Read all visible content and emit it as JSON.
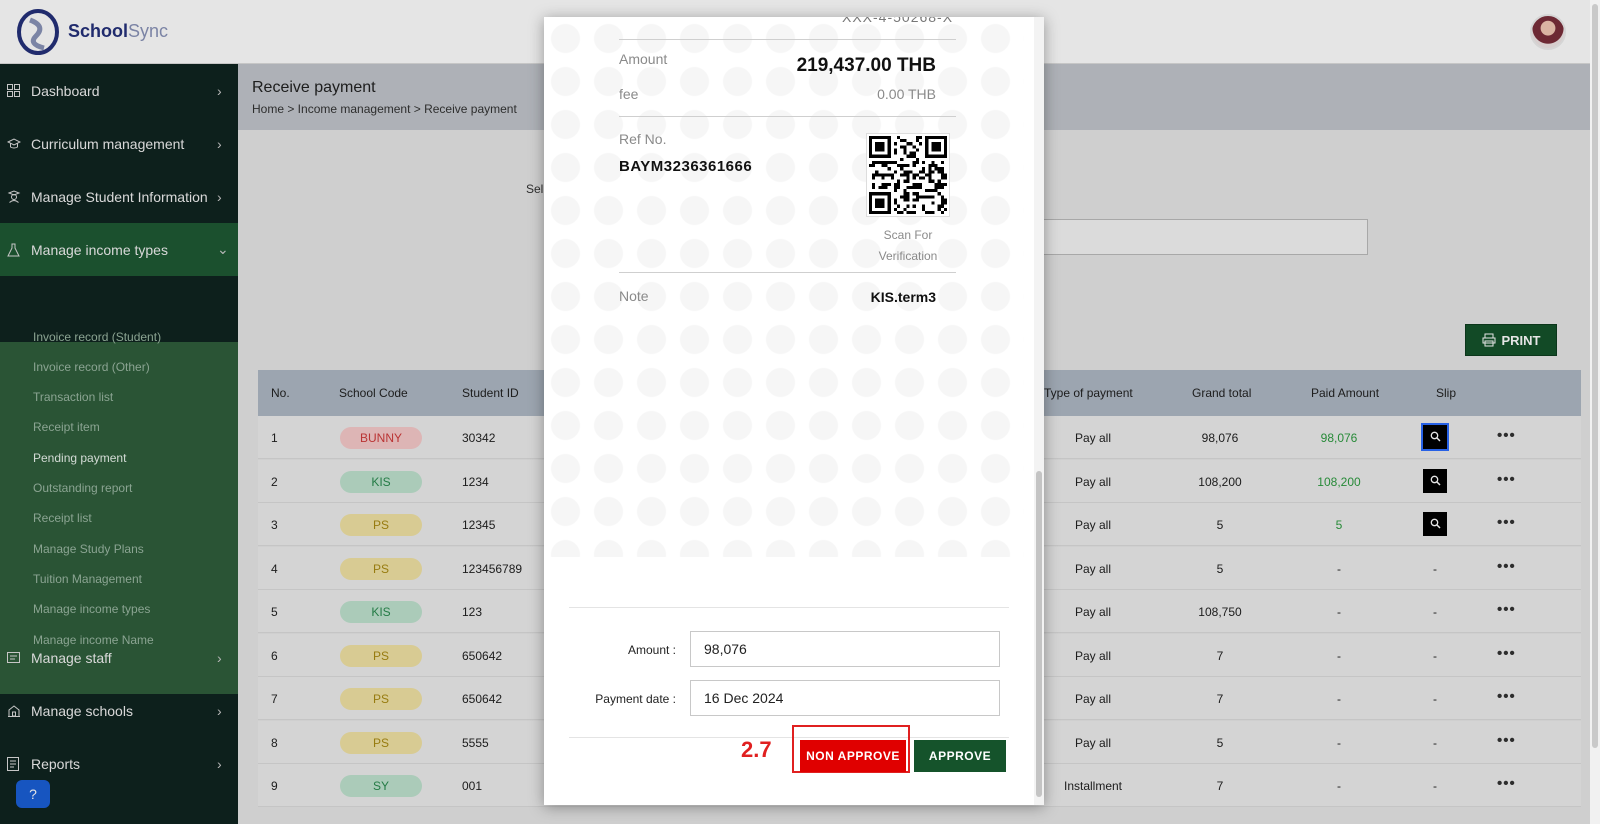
{
  "app": {
    "logo_a": "School",
    "logo_b": "Sync"
  },
  "sidebar": {
    "items": [
      {
        "label": "Dashboard",
        "icon": "grid-icon"
      },
      {
        "label": "Curriculum management",
        "icon": "graduation-cap-icon"
      },
      {
        "label": "Manage Student Information",
        "icon": "student-icon"
      },
      {
        "label": "Manage income types",
        "icon": "flask-icon"
      },
      {
        "label": "Manage staff",
        "icon": "staff-icon"
      },
      {
        "label": "Manage schools",
        "icon": "school-icon"
      },
      {
        "label": "Reports",
        "icon": "report-icon"
      }
    ],
    "subitems": [
      "Invoice record (Student)",
      "Invoice record (Other)",
      "Transaction list",
      "Receipt item",
      "Pending payment",
      "Outstanding report",
      "Receipt list",
      "Manage Study Plans",
      "Tuition Management",
      "Manage income types",
      "Manage income Name"
    ]
  },
  "page": {
    "title": "Receive payment",
    "breadcrumb": "Home > Income management > Receive payment",
    "select_label": "Sel",
    "print_label": "PRINT"
  },
  "table": {
    "headers": [
      "No.",
      "School Code",
      "Student ID",
      "Type of payment",
      "Grand total",
      "Paid Amount",
      "Slip"
    ],
    "rows": [
      {
        "no": "1",
        "code": "BUNNY",
        "student_id": "30342",
        "type": "Pay all",
        "grand_total": "98,076",
        "paid": "98,076",
        "slip": true
      },
      {
        "no": "2",
        "code": "KIS",
        "student_id": "1234",
        "type": "Pay all",
        "grand_total": "108,200",
        "paid": "108,200",
        "slip": true
      },
      {
        "no": "3",
        "code": "PS",
        "student_id": "12345",
        "type": "Pay all",
        "grand_total": "5",
        "paid": "5",
        "slip": true
      },
      {
        "no": "4",
        "code": "PS",
        "student_id": "123456789",
        "type": "Pay all",
        "grand_total": "5",
        "paid": "-",
        "slip": false
      },
      {
        "no": "5",
        "code": "KIS",
        "student_id": "123",
        "type": "Pay all",
        "grand_total": "108,750",
        "paid": "-",
        "slip": false
      },
      {
        "no": "6",
        "code": "PS",
        "student_id": "650642",
        "type": "Pay all",
        "grand_total": "7",
        "paid": "-",
        "slip": false
      },
      {
        "no": "7",
        "code": "PS",
        "student_id": "650642",
        "type": "Pay all",
        "grand_total": "7",
        "paid": "-",
        "slip": false
      },
      {
        "no": "8",
        "code": "PS",
        "student_id": "5555",
        "type": "Pay all",
        "grand_total": "5",
        "paid": "-",
        "slip": false
      },
      {
        "no": "9",
        "code": "SY",
        "student_id": "001",
        "type": "Installment",
        "grand_total": "7",
        "paid": "-",
        "slip": false
      }
    ],
    "slip_empty": "-",
    "pill_colors": {
      "BUNNY": {
        "bg": "#f6caca",
        "fg": "#d03a3a"
      },
      "KIS": {
        "bg": "#bfe3cf",
        "fg": "#2a8a4f"
      },
      "PS": {
        "bg": "#f1e3a4",
        "fg": "#a98a12"
      },
      "SY": {
        "bg": "#bfe3cf",
        "fg": "#2a8a4f"
      }
    }
  },
  "modal": {
    "cut_text": "XXX-4-50268-X",
    "amount_label": "Amount",
    "amount_value": "219,437.00 THB",
    "fee_label": "fee",
    "fee_value": "0.00 THB",
    "ref_label": "Ref No.",
    "ref_value": "BAYM3236361666",
    "scan_text": "Scan For Verification",
    "note_label": "Note",
    "note_value": "KIS.term3",
    "form_amount_label": "Amount :",
    "form_amount_value": "98,076",
    "form_date_label": "Payment date :",
    "form_date_value": "16 Dec 2024",
    "step_label": "2.7",
    "non_approve_label": "NON APPROVE",
    "approve_label": "APPROVE"
  }
}
